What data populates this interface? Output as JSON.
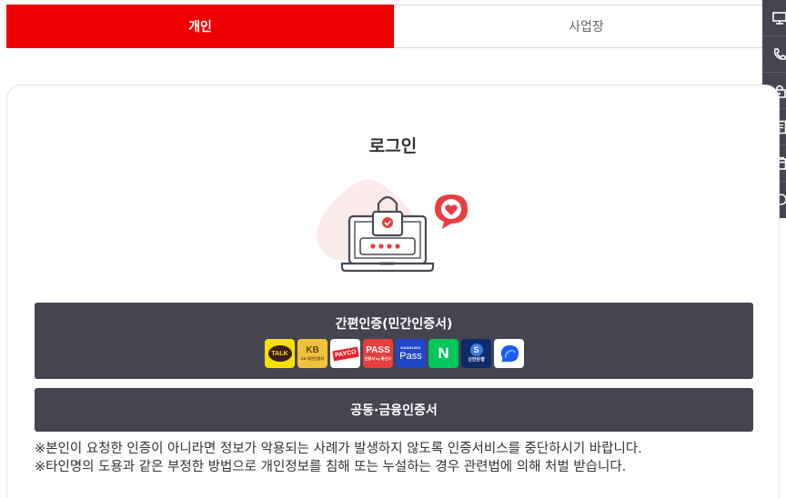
{
  "tabs": [
    {
      "label": "개인",
      "active": true
    },
    {
      "label": "사업장",
      "active": false
    }
  ],
  "quick_menu": [
    "monitor-icon",
    "phone-icon",
    "lock-icon",
    "document-icon",
    "card-icon",
    "chat-icon"
  ],
  "login": {
    "title": "로그인",
    "illustration": "laptop-lock-icon"
  },
  "easy_auth": {
    "label": "간편인증(민간인증서)",
    "providers": [
      {
        "name": "kakao-talk",
        "text": "TALK"
      },
      {
        "name": "kb",
        "text": "KB",
        "subtext": "KB 국민인증서"
      },
      {
        "name": "payco",
        "text": "PAYCO"
      },
      {
        "name": "pass",
        "text": "PASS",
        "subtext": "인증서 by 통신사"
      },
      {
        "name": "samsung-pass",
        "text": "Pass",
        "subtext": "SAMSUNG"
      },
      {
        "name": "naver",
        "text": "N"
      },
      {
        "name": "shinhan",
        "text": "S",
        "subtext": "신한은행"
      },
      {
        "name": "toss",
        "text": ""
      }
    ]
  },
  "joint_cert": {
    "label": "공동·금융인증서"
  },
  "notices": [
    "※본인이 요청한 인증이 아니라면 정보가 악용되는 사례가 발생하지 않도록 인증서비스를 중단하시기 바랍니다.",
    "※타인명의 도용과 같은 부정한 방법으로 개인정보를 침해 또는 누설하는 경우 관련법에 의해 처벌 받습니다."
  ],
  "colors": {
    "accent": "#ee0000",
    "button_bg": "#454552",
    "quick_bar_bg": "#454552"
  }
}
